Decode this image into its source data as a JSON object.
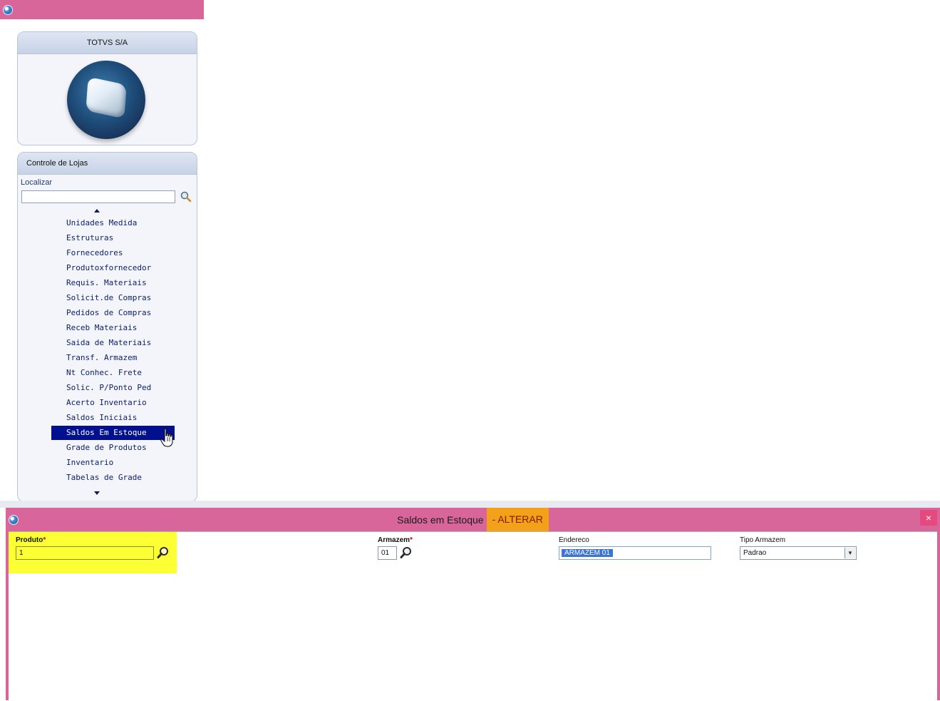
{
  "app": {
    "company": "TOTVS S/A",
    "module": "Controle de Lojas"
  },
  "search": {
    "label": "Localizar",
    "value": ""
  },
  "menu": {
    "items": [
      "Unidades Medida",
      "Estruturas",
      "Fornecedores",
      "Produtoxfornecedor",
      "Requis. Materiais",
      "Solicit.de Compras",
      "Pedidos de Compras",
      "Receb Materiais",
      "Saida de Materiais",
      "Transf. Armazem",
      "Nt Conhec. Frete",
      "Solic. P/Ponto Ped",
      "Acerto Inventario",
      "Saldos Iniciais",
      "Saldos Em Estoque",
      "Grade de Produtos",
      "Inventario",
      "Tabelas de Grade"
    ],
    "selected": "Saldos Em Estoque"
  },
  "dialog": {
    "title": "Saldos em Estoque",
    "mode": "- ALTERAR",
    "close": "×",
    "fields": {
      "produto": {
        "label": "Produto",
        "required": "*",
        "value": "1"
      },
      "armazem": {
        "label": "Armazem",
        "required": "*",
        "value": "01"
      },
      "endereco": {
        "label": "Endereco",
        "value": "ARMAZEM 01"
      },
      "tipo_armazem": {
        "label": "Tipo Armazem",
        "value": "Padrao"
      }
    }
  },
  "colors": {
    "titlebar": "#d9669a",
    "selection": "#00108f",
    "highlight": "#fcff33",
    "mode_highlight": "#f4a11a"
  }
}
